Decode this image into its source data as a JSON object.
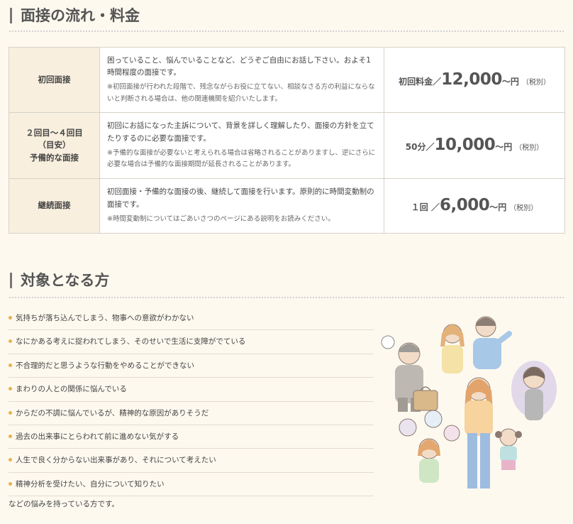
{
  "section1": {
    "title": "面接の流れ・料金",
    "rows": [
      {
        "name": "初回面接",
        "desc": "困っていること、悩んでいることなど、どうぞご自由にお話し下さい。およそ1時間程度の面接です。",
        "note": "※初回面接が行われた段階で、残念ながらお役に立てない、相談なさる方の利益にならないと判断される場合は、他の関連機関を紹介いたします。",
        "fee_prefix": "初回料金／",
        "fee_amount": "12,000",
        "fee_suffix": "〜円",
        "fee_tax": "（税別）"
      },
      {
        "name1": "２回目〜４回目",
        "name2": "（目安）",
        "name3": "予備的な面接",
        "desc": "初回にお話になった主訴について、背景を詳しく理解したり、面接の方針を立てたりするのに必要な面接です。",
        "note": "※予備的な面接が必要ないと考えられる場合は省略されることがありますし、逆にさらに必要な場合は予備的な面接期間が延長されることがあります。",
        "fee_prefix": "50分／",
        "fee_amount": "10,000",
        "fee_suffix": "〜円",
        "fee_tax": "（税別）"
      },
      {
        "name": "継続面接",
        "desc": "初回面接・予備的な面接の後、継続して面接を行います。原則的に時間変動制の面接です。",
        "note": "※時間変動制についてはごあいさつのページにある説明をお読みください。",
        "fee_prefix": "１回 ／",
        "fee_amount": "6,000",
        "fee_suffix": "〜円",
        "fee_tax": "（税別）"
      }
    ]
  },
  "section2": {
    "title": "対象となる方",
    "items": [
      "気持ちが落ち込んでしまう、物事への意欲がわかない",
      "なにかある考えに捉われてしまう、そのせいで生活に支障がでている",
      "不合理的だと思うような行動をやめることができない",
      "まわりの人との関係に悩んでいる",
      "からだの不調に悩んでいるが、精神的な原因がありそうだ",
      "過去の出来事にとらわれて前に進めない気がする",
      "人生で良く分からない出来事があり、それについて考えたい",
      "精神分析を受けたい、自分について知りたい"
    ],
    "closing": "などの悩みを持っている方です。"
  },
  "colors": {
    "background": "#fdf9ef",
    "header_cell": "#f8efdf",
    "bullet": "#e8b24a",
    "border": "#d8d2c6"
  }
}
